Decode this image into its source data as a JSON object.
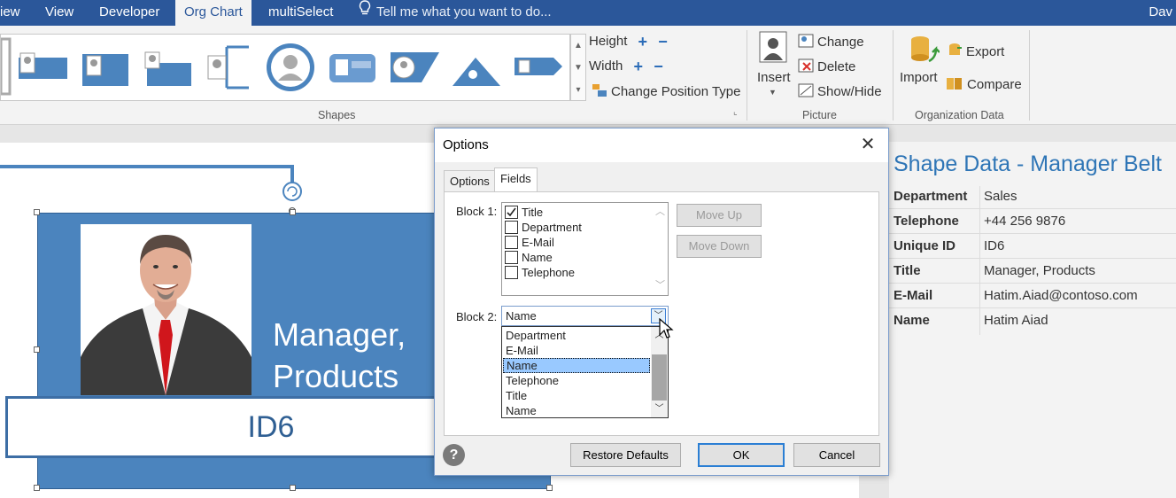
{
  "tabs": [
    {
      "label": "iew",
      "active": false
    },
    {
      "label": "View",
      "active": false
    },
    {
      "label": "Developer",
      "active": false
    },
    {
      "label": "Org Chart",
      "active": true
    },
    {
      "label": "multiSelect",
      "active": false
    }
  ],
  "tell_me": "Tell me what you want to do...",
  "user_name": "Dav",
  "ribbon": {
    "shapes_group": {
      "label": "Shapes",
      "height_label": "Height",
      "width_label": "Width",
      "change_position_type": "Change Position Type"
    },
    "picture_group": {
      "label": "Picture",
      "insert": "Insert",
      "change": "Change",
      "delete": "Delete",
      "show_hide": "Show/Hide"
    },
    "org_data_group": {
      "label": "Organization Data",
      "import": "Import",
      "export": "Export",
      "compare": "Compare"
    }
  },
  "canvas": {
    "shape_title": [
      "Manager,",
      "Products"
    ],
    "shape_id": "ID6"
  },
  "shape_data": {
    "title": "Shape Data - Manager Belt",
    "rows": [
      {
        "key": "Department",
        "value": "Sales"
      },
      {
        "key": "Telephone",
        "value": "+44 256 9876"
      },
      {
        "key": "Unique ID",
        "value": "ID6"
      },
      {
        "key": "Title",
        "value": "Manager, Products"
      },
      {
        "key": "E-Mail",
        "value": "Hatim.Aiad@contoso.com"
      },
      {
        "key": "Name",
        "value": "Hatim Aiad"
      }
    ]
  },
  "dialog": {
    "title": "Options",
    "close": "✕",
    "tabs": [
      {
        "label": "Options",
        "active": false
      },
      {
        "label": "Fields",
        "active": true
      }
    ],
    "block1_label": "Block 1:",
    "block1_items": [
      {
        "label": "Title",
        "checked": true
      },
      {
        "label": "Department",
        "checked": false
      },
      {
        "label": "E-Mail",
        "checked": false
      },
      {
        "label": "Name",
        "checked": false
      },
      {
        "label": "Telephone",
        "checked": false
      }
    ],
    "move_up": "Move Up",
    "move_down": "Move Down",
    "block2_label": "Block 2:",
    "block2_value": "Name",
    "block2_options": [
      {
        "label": "Department",
        "selected": false
      },
      {
        "label": "E-Mail",
        "selected": false
      },
      {
        "label": "Name",
        "selected": true
      },
      {
        "label": "Telephone",
        "selected": false
      },
      {
        "label": "Title",
        "selected": false
      },
      {
        "label": "Name",
        "selected": false
      }
    ],
    "help": "?",
    "restore_defaults": "Restore Defaults",
    "ok": "OK",
    "cancel": "Cancel"
  },
  "colors": {
    "tabbar": "#2b579a",
    "shape_fill": "#4b84be",
    "accent": "#2e75b6",
    "dropdown_selection": "#99c9ff"
  }
}
